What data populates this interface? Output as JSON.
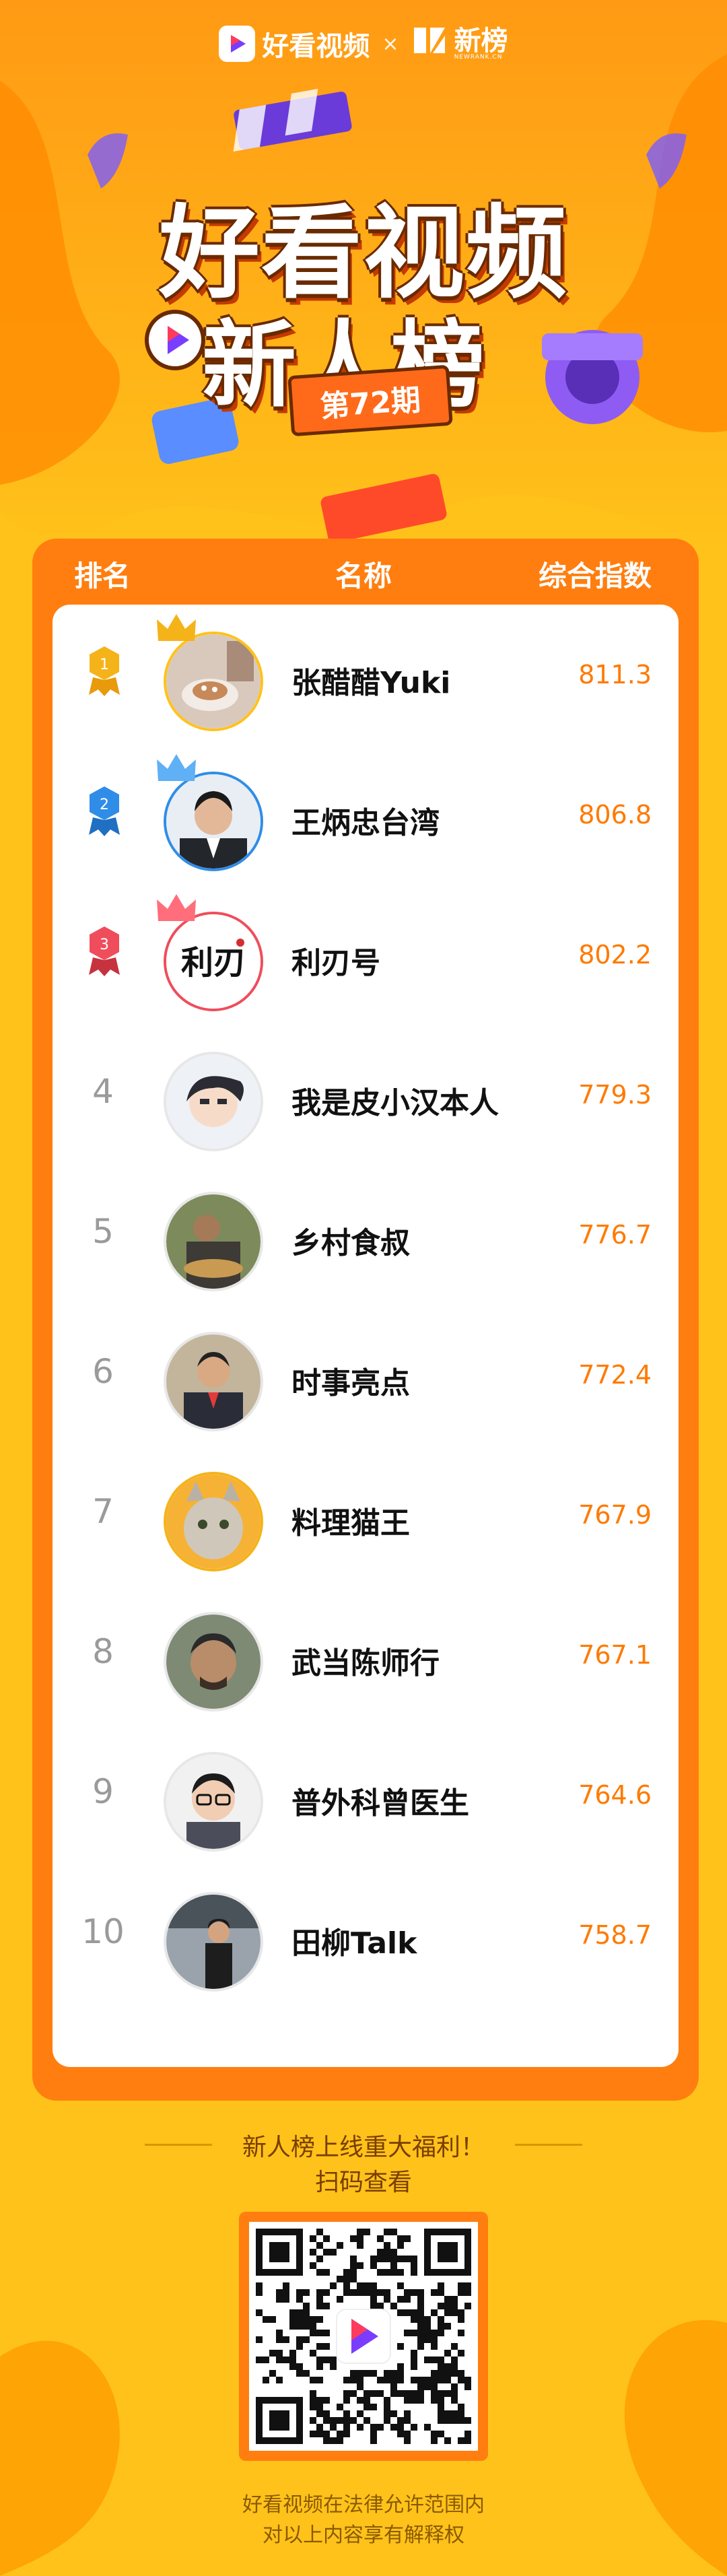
{
  "brand": {
    "app_name": "好看视频",
    "separator": "×",
    "partner_name": "新榜",
    "partner_sub": "NEWRANK.CN"
  },
  "hero": {
    "title_line1": "好看视频",
    "title_line2": "新人榜",
    "issue": "第72期"
  },
  "table": {
    "headers": {
      "rank": "排名",
      "name": "名称",
      "score": "综合指数"
    },
    "rows": [
      {
        "rank": "1",
        "name": "张醋醋Yuki",
        "score": "811.3",
        "medal": "gold"
      },
      {
        "rank": "2",
        "name": "王炳忠台湾",
        "score": "806.8",
        "medal": "blue"
      },
      {
        "rank": "3",
        "name": "利刃号",
        "score": "802.2",
        "medal": "red"
      },
      {
        "rank": "4",
        "name": "我是皮小汉本人",
        "score": "779.3"
      },
      {
        "rank": "5",
        "name": "乡村食叔",
        "score": "776.7"
      },
      {
        "rank": "6",
        "name": "时事亮点",
        "score": "772.4"
      },
      {
        "rank": "7",
        "name": "料理猫王",
        "score": "767.9"
      },
      {
        "rank": "8",
        "name": "武当陈师行",
        "score": "767.1"
      },
      {
        "rank": "9",
        "name": "普外科曾医生",
        "score": "764.6"
      },
      {
        "rank": "10",
        "name": "田柳Talk",
        "score": "758.7"
      }
    ]
  },
  "avatar_logo_text": "利刃",
  "footer": {
    "promo_line1": "新人榜上线重大福利！",
    "promo_line2": "扫码查看",
    "disclaimer_line1": "好看视频在法律允许范围内",
    "disclaimer_line2": "对以上内容享有解释权"
  },
  "colors": {
    "background": "#ffc21a",
    "panel": "#ff7e0f",
    "score": "#ff7a00",
    "medal_gold": "#f5b31a",
    "medal_blue": "#2f8de8",
    "medal_red": "#ef4d5b"
  }
}
